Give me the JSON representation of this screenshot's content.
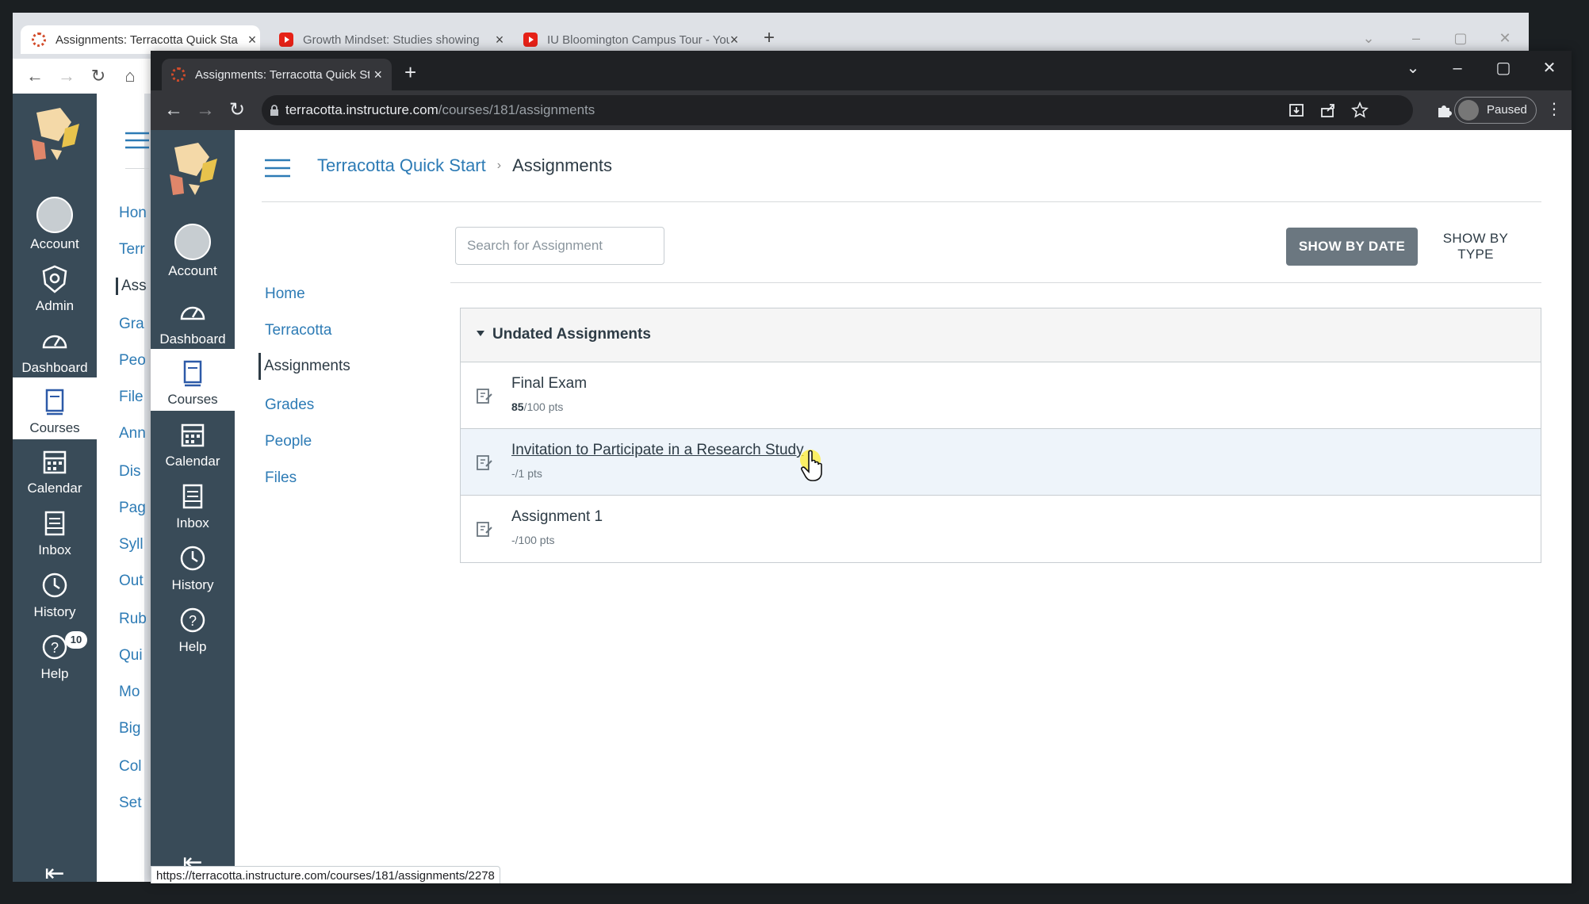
{
  "back_window": {
    "tabs": [
      {
        "title": "Assignments: Terracotta Quick Start",
        "icon": "canvas-logo-icon"
      },
      {
        "title": "Growth Mindset: Studies showing",
        "icon": "youtube-icon"
      },
      {
        "title": "IU Bloomington Campus Tour - YouTube",
        "icon": "youtube-icon"
      }
    ],
    "global_nav": [
      {
        "label": "Account"
      },
      {
        "label": "Admin"
      },
      {
        "label": "Dashboard"
      },
      {
        "label": "Courses"
      },
      {
        "label": "Calendar"
      },
      {
        "label": "Inbox"
      },
      {
        "label": "History"
      },
      {
        "label": "Help",
        "badge": "10"
      }
    ],
    "course_nav_fragments": [
      "Hon",
      "Terr",
      "Ass",
      "Gra",
      "Peo",
      "File",
      "Ann",
      "Dis",
      "Pag",
      "Syll",
      "Out",
      "Rub",
      "Qui",
      "Mo",
      "Big",
      "Col",
      "Set"
    ]
  },
  "front_window": {
    "tab_title": "Assignments: Terracotta Quick Start",
    "url_host": "terracotta.instructure.com",
    "url_path": "/courses/181/assignments",
    "profile_label": "Paused",
    "global_nav": [
      {
        "label": "Account"
      },
      {
        "label": "Dashboard"
      },
      {
        "label": "Courses"
      },
      {
        "label": "Calendar"
      },
      {
        "label": "Inbox"
      },
      {
        "label": "History"
      },
      {
        "label": "Help"
      }
    ],
    "breadcrumb": {
      "course": "Terracotta Quick Start",
      "current": "Assignments"
    },
    "course_nav": [
      "Home",
      "Terracotta",
      "Assignments",
      "Grades",
      "People",
      "Files"
    ],
    "search_placeholder": "Search for Assignment",
    "show_by_date": "SHOW BY DATE",
    "show_by_type": "SHOW BY TYPE",
    "group_title": "Undated Assignments",
    "assignments": [
      {
        "name": "Final Exam",
        "score": "85",
        "total": "/100 pts"
      },
      {
        "name": "Invitation to Participate in a Research Study",
        "score": "",
        "total": "-/1 pts"
      },
      {
        "name": "Assignment 1",
        "score": "",
        "total": "-/100 pts"
      }
    ],
    "status_url": "https://terracotta.instructure.com/courses/181/assignments/2278"
  },
  "colors": {
    "nav_bg": "#394b58",
    "link": "#2d7bb5",
    "text": "#2d3b45",
    "button_gray": "#6b7780",
    "hover_row": "#eef4fa"
  }
}
